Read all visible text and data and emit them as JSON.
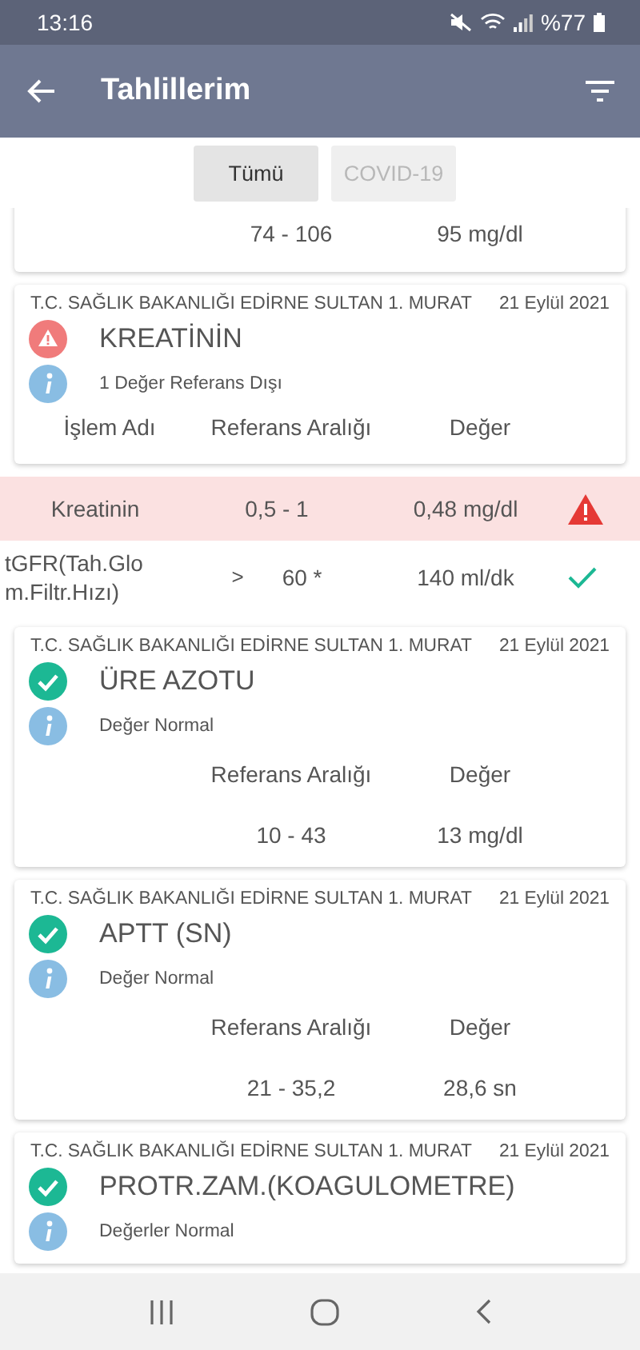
{
  "status_bar": {
    "time": "13:16",
    "battery": "%77"
  },
  "app_bar": {
    "title": "Tahlillerim"
  },
  "tabs": [
    {
      "label": "Tümü",
      "selected": true
    },
    {
      "label": "COVID-19",
      "selected": false
    }
  ],
  "results": [
    {
      "rows": [
        {
          "reference": "74 - 106",
          "value": "95 mg/dl"
        }
      ]
    },
    {
      "hospital": "T.C. SAĞLIK BAKANLIĞI EDİRNE SULTAN 1. MURAT",
      "date": "21 Eylül 2021",
      "out_of_range": true,
      "title": "KREATİNİN",
      "note": "1 Değer Referans Dışı",
      "columns": [
        "İşlem Adı",
        "Referans Aralığı",
        "Değer"
      ],
      "detail_rows": [
        {
          "name": "Kreatinin",
          "reference": "0,5 - 1",
          "value": "0,48 mg/dl",
          "out_of_range": true
        },
        {
          "name": "tGFR(Tah.Glom.Filtr.Hızı)",
          "operator": ">",
          "reference": "60 *",
          "value": "140 ml/dk",
          "out_of_range": false
        }
      ]
    },
    {
      "hospital": "T.C. SAĞLIK BAKANLIĞI EDİRNE SULTAN 1. MURAT",
      "date": "21 Eylül 2021",
      "out_of_range": false,
      "title": "ÜRE AZOTU",
      "note": "Değer Normal",
      "columns": [
        "Referans Aralığı",
        "Değer"
      ],
      "rows": [
        {
          "reference": "10 - 43",
          "value": "13 mg/dl"
        }
      ]
    },
    {
      "hospital": "T.C. SAĞLIK BAKANLIĞI EDİRNE SULTAN 1. MURAT",
      "date": "21 Eylül 2021",
      "out_of_range": false,
      "title": "APTT (SN)",
      "note": "Değer Normal",
      "columns": [
        "Referans Aralığı",
        "Değer"
      ],
      "rows": [
        {
          "reference": "21 - 35,2",
          "value": "28,6 sn"
        }
      ]
    },
    {
      "hospital": "T.C. SAĞLIK BAKANLIĞI EDİRNE SULTAN 1. MURAT",
      "date": "21 Eylül 2021",
      "out_of_range": false,
      "title": "PROTR.ZAM.(KOAGULOMETRE)",
      "note": "Değerler Normal"
    }
  ]
}
